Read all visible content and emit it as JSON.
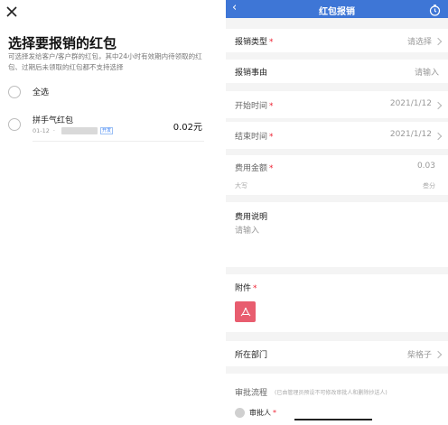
{
  "left": {
    "title": "选择要报销的红包",
    "description": "可选择发给客户/客户群的红包，其中24小时有效期内待领取的红包、过期后未领取的红包都不支持选择",
    "select_all": "全选",
    "items": [
      {
        "name": "拼手气红包",
        "date": "01-12",
        "sep": "·",
        "tag": "开发",
        "amount": "0.02元"
      }
    ]
  },
  "right": {
    "header": {
      "title": "红包报销",
      "back_icon": "chevron-left-icon",
      "action_icon": "timer-icon"
    },
    "fields": {
      "type": {
        "label": "报销类型",
        "value": "请选择"
      },
      "reason": {
        "label": "报销事由",
        "placeholder": "请输入"
      },
      "start": {
        "label": "开始时间",
        "value": "2021/1/12"
      },
      "end": {
        "label": "结束时间",
        "value": "2021/1/12"
      },
      "amount": {
        "label": "费用金额",
        "value": "0.03",
        "uppercase_label": "大写",
        "uppercase_value": "叁分"
      },
      "description": {
        "label": "费用说明",
        "placeholder": "请输入"
      },
      "attachment": {
        "label": "附件"
      },
      "department": {
        "label": "所在部门",
        "value": "柴格子"
      },
      "approval": {
        "label": "审批流程",
        "note": "(已由管理员预设不可修改审批人和删除抄送人)",
        "approver_label": "审批人"
      }
    },
    "required_mark": "*"
  },
  "colors": {
    "header": "#3e76d6",
    "required": "#e22233",
    "pdf": "#e85d6f"
  }
}
